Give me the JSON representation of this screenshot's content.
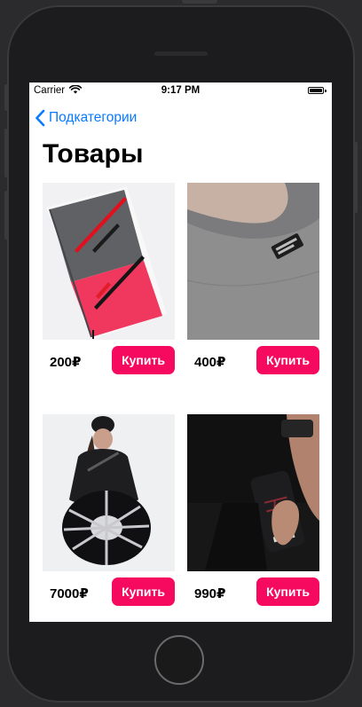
{
  "status_bar": {
    "carrier": "Carrier",
    "time": "9:17 PM"
  },
  "nav": {
    "back_label": "Подкатегории"
  },
  "page": {
    "title": "Товары"
  },
  "products": [
    {
      "price": "200₽",
      "buy_label": "Купить"
    },
    {
      "price": "400₽",
      "buy_label": "Купить"
    },
    {
      "price": "7000₽",
      "buy_label": "Купить"
    },
    {
      "price": "990₽",
      "buy_label": "Купить"
    }
  ],
  "colors": {
    "accent": "#f50a5f",
    "link": "#0a7aff"
  }
}
